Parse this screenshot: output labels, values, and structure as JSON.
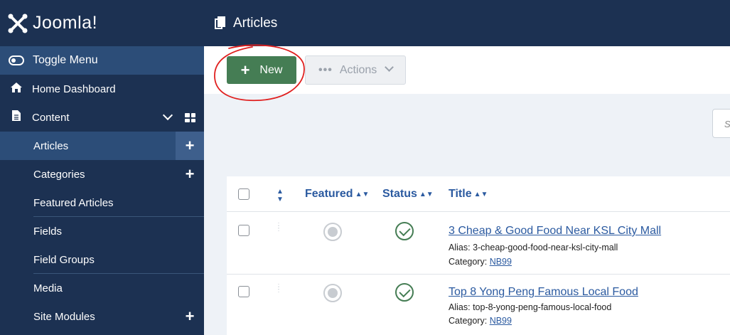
{
  "brand": {
    "name": "Joomla!"
  },
  "header": {
    "title": "Articles"
  },
  "sidebar": {
    "toggle_label": "Toggle Menu",
    "home_label": "Home Dashboard",
    "content_label": "Content",
    "items": [
      {
        "label": "Articles",
        "active": true,
        "add": true
      },
      {
        "label": "Categories",
        "active": false,
        "add": true
      },
      {
        "label": "Featured Articles",
        "active": false,
        "add": false
      },
      {
        "label": "Fields",
        "active": false,
        "add": false
      },
      {
        "label": "Field Groups",
        "active": false,
        "add": false
      },
      {
        "label": "Media",
        "active": false,
        "add": false
      },
      {
        "label": "Site Modules",
        "active": false,
        "add": true
      }
    ]
  },
  "toolbar": {
    "new_label": "New",
    "actions_label": "Actions"
  },
  "search": {
    "placeholder": "S"
  },
  "table": {
    "columns": {
      "featured": "Featured",
      "status": "Status",
      "title": "Title"
    },
    "rows": [
      {
        "title": "3 Cheap & Good Food Near KSL City Mall",
        "alias_label": "Alias:",
        "alias": "3-cheap-good-food-near-ksl-city-mall",
        "category_label": "Category:",
        "category": "NB99"
      },
      {
        "title": "Top 8 Yong Peng Famous Local Food",
        "alias_label": "Alias:",
        "alias": "top-8-yong-peng-famous-local-food",
        "category_label": "Category:",
        "category": "NB99"
      }
    ]
  },
  "colors": {
    "sidebar": "#1c3152",
    "accent": "#2c4d78",
    "success": "#457d54",
    "link": "#2b5aa0",
    "annotation": "#e0201f"
  }
}
